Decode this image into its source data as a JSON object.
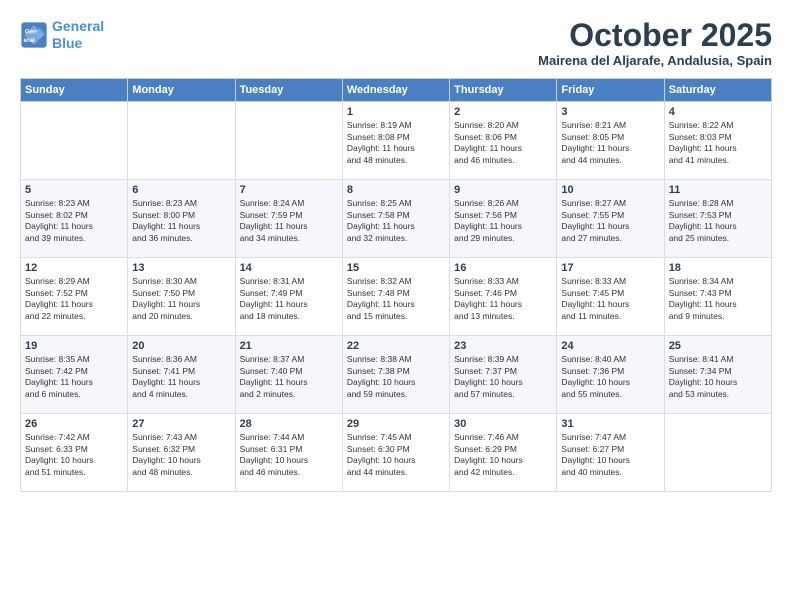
{
  "header": {
    "logo_line1": "General",
    "logo_line2": "Blue",
    "month": "October 2025",
    "location": "Mairena del Aljarafe, Andalusia, Spain"
  },
  "days_of_week": [
    "Sunday",
    "Monday",
    "Tuesday",
    "Wednesday",
    "Thursday",
    "Friday",
    "Saturday"
  ],
  "weeks": [
    [
      {
        "day": "",
        "info": ""
      },
      {
        "day": "",
        "info": ""
      },
      {
        "day": "",
        "info": ""
      },
      {
        "day": "1",
        "info": "Sunrise: 8:19 AM\nSunset: 8:08 PM\nDaylight: 11 hours\nand 48 minutes."
      },
      {
        "day": "2",
        "info": "Sunrise: 8:20 AM\nSunset: 8:06 PM\nDaylight: 11 hours\nand 46 minutes."
      },
      {
        "day": "3",
        "info": "Sunrise: 8:21 AM\nSunset: 8:05 PM\nDaylight: 11 hours\nand 44 minutes."
      },
      {
        "day": "4",
        "info": "Sunrise: 8:22 AM\nSunset: 8:03 PM\nDaylight: 11 hours\nand 41 minutes."
      }
    ],
    [
      {
        "day": "5",
        "info": "Sunrise: 8:23 AM\nSunset: 8:02 PM\nDaylight: 11 hours\nand 39 minutes."
      },
      {
        "day": "6",
        "info": "Sunrise: 8:23 AM\nSunset: 8:00 PM\nDaylight: 11 hours\nand 36 minutes."
      },
      {
        "day": "7",
        "info": "Sunrise: 8:24 AM\nSunset: 7:59 PM\nDaylight: 11 hours\nand 34 minutes."
      },
      {
        "day": "8",
        "info": "Sunrise: 8:25 AM\nSunset: 7:58 PM\nDaylight: 11 hours\nand 32 minutes."
      },
      {
        "day": "9",
        "info": "Sunrise: 8:26 AM\nSunset: 7:56 PM\nDaylight: 11 hours\nand 29 minutes."
      },
      {
        "day": "10",
        "info": "Sunrise: 8:27 AM\nSunset: 7:55 PM\nDaylight: 11 hours\nand 27 minutes."
      },
      {
        "day": "11",
        "info": "Sunrise: 8:28 AM\nSunset: 7:53 PM\nDaylight: 11 hours\nand 25 minutes."
      }
    ],
    [
      {
        "day": "12",
        "info": "Sunrise: 8:29 AM\nSunset: 7:52 PM\nDaylight: 11 hours\nand 22 minutes."
      },
      {
        "day": "13",
        "info": "Sunrise: 8:30 AM\nSunset: 7:50 PM\nDaylight: 11 hours\nand 20 minutes."
      },
      {
        "day": "14",
        "info": "Sunrise: 8:31 AM\nSunset: 7:49 PM\nDaylight: 11 hours\nand 18 minutes."
      },
      {
        "day": "15",
        "info": "Sunrise: 8:32 AM\nSunset: 7:48 PM\nDaylight: 11 hours\nand 15 minutes."
      },
      {
        "day": "16",
        "info": "Sunrise: 8:33 AM\nSunset: 7:46 PM\nDaylight: 11 hours\nand 13 minutes."
      },
      {
        "day": "17",
        "info": "Sunrise: 8:33 AM\nSunset: 7:45 PM\nDaylight: 11 hours\nand 11 minutes."
      },
      {
        "day": "18",
        "info": "Sunrise: 8:34 AM\nSunset: 7:43 PM\nDaylight: 11 hours\nand 9 minutes."
      }
    ],
    [
      {
        "day": "19",
        "info": "Sunrise: 8:35 AM\nSunset: 7:42 PM\nDaylight: 11 hours\nand 6 minutes."
      },
      {
        "day": "20",
        "info": "Sunrise: 8:36 AM\nSunset: 7:41 PM\nDaylight: 11 hours\nand 4 minutes."
      },
      {
        "day": "21",
        "info": "Sunrise: 8:37 AM\nSunset: 7:40 PM\nDaylight: 11 hours\nand 2 minutes."
      },
      {
        "day": "22",
        "info": "Sunrise: 8:38 AM\nSunset: 7:38 PM\nDaylight: 10 hours\nand 59 minutes."
      },
      {
        "day": "23",
        "info": "Sunrise: 8:39 AM\nSunset: 7:37 PM\nDaylight: 10 hours\nand 57 minutes."
      },
      {
        "day": "24",
        "info": "Sunrise: 8:40 AM\nSunset: 7:36 PM\nDaylight: 10 hours\nand 55 minutes."
      },
      {
        "day": "25",
        "info": "Sunrise: 8:41 AM\nSunset: 7:34 PM\nDaylight: 10 hours\nand 53 minutes."
      }
    ],
    [
      {
        "day": "26",
        "info": "Sunrise: 7:42 AM\nSunset: 6:33 PM\nDaylight: 10 hours\nand 51 minutes."
      },
      {
        "day": "27",
        "info": "Sunrise: 7:43 AM\nSunset: 6:32 PM\nDaylight: 10 hours\nand 48 minutes."
      },
      {
        "day": "28",
        "info": "Sunrise: 7:44 AM\nSunset: 6:31 PM\nDaylight: 10 hours\nand 46 minutes."
      },
      {
        "day": "29",
        "info": "Sunrise: 7:45 AM\nSunset: 6:30 PM\nDaylight: 10 hours\nand 44 minutes."
      },
      {
        "day": "30",
        "info": "Sunrise: 7:46 AM\nSunset: 6:29 PM\nDaylight: 10 hours\nand 42 minutes."
      },
      {
        "day": "31",
        "info": "Sunrise: 7:47 AM\nSunset: 6:27 PM\nDaylight: 10 hours\nand 40 minutes."
      },
      {
        "day": "",
        "info": ""
      }
    ]
  ]
}
